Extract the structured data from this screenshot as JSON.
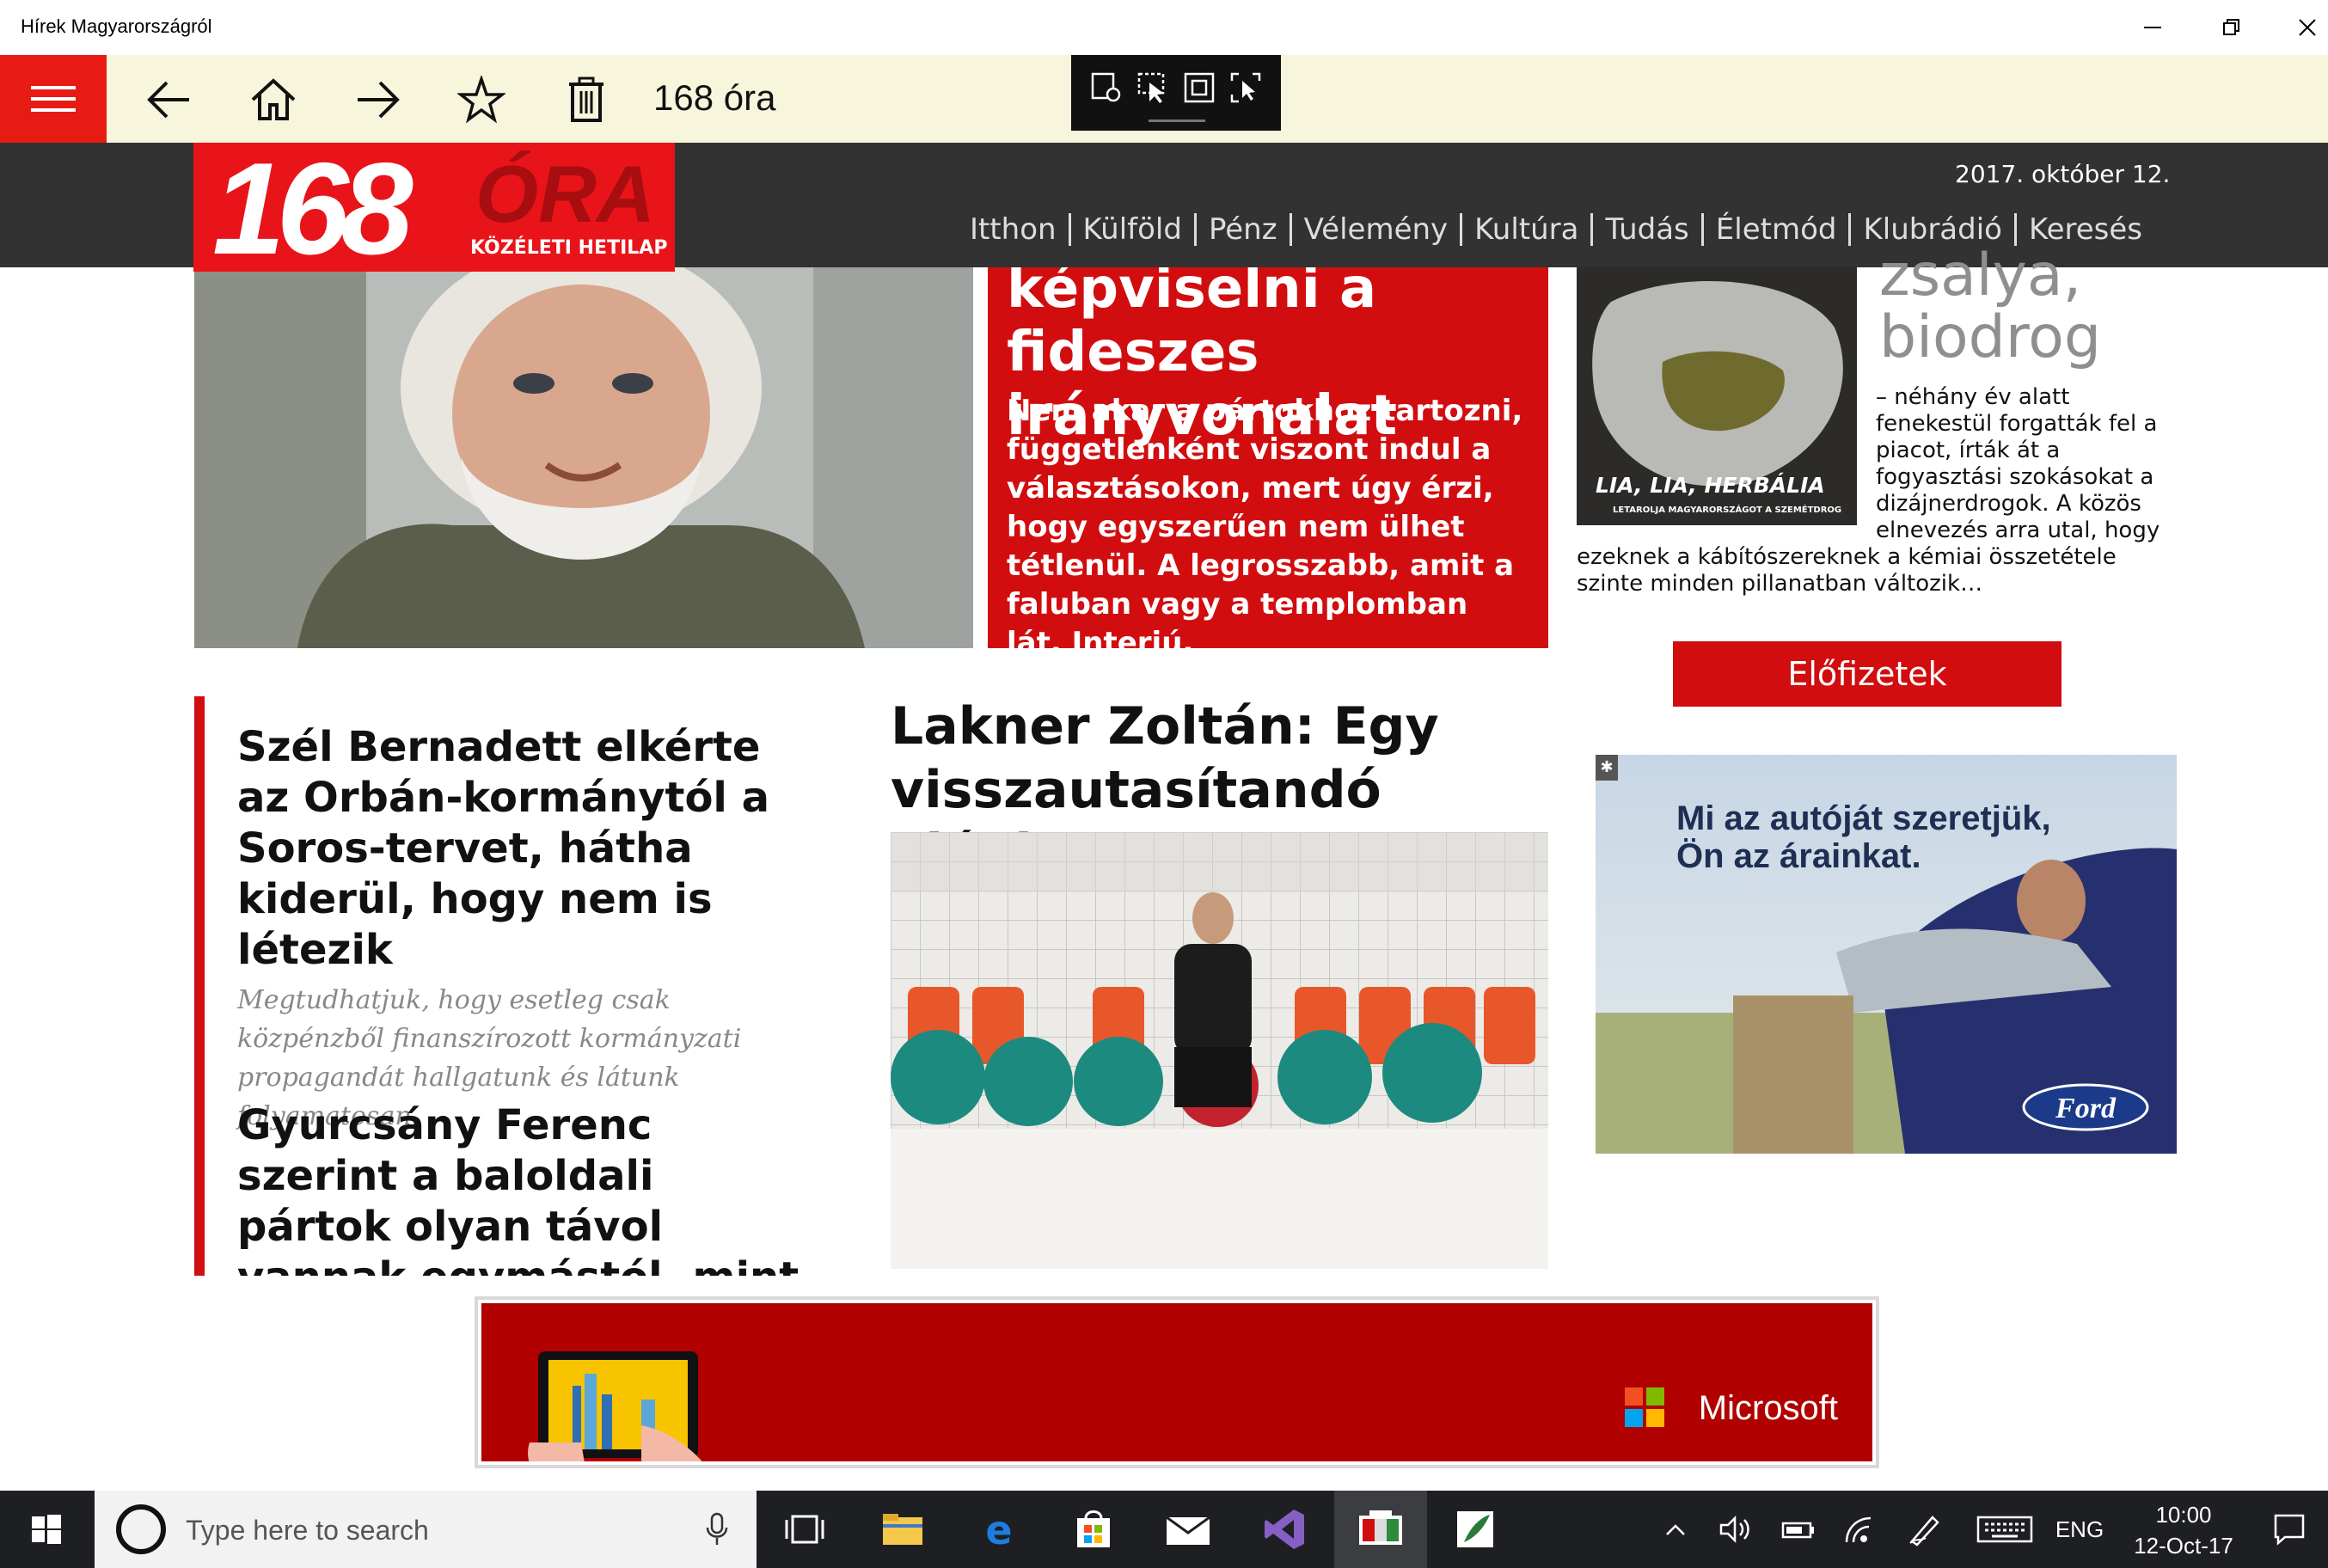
{
  "window": {
    "title": "Hírek Magyarországról"
  },
  "toolbar": {
    "title": "168 óra"
  },
  "site": {
    "logo_number": "168",
    "logo_word": "ÓRA",
    "logo_sub": "KÖZÉLETI HETILAP",
    "date": "2017. október 12.",
    "nav": [
      "Itthon",
      "Külföld",
      "Pénz",
      "Vélemény",
      "Kultúra",
      "Tudás",
      "Életmód",
      "Klubrádió",
      "Keresés"
    ]
  },
  "hero": {
    "title_lines": [
      "képviselni a",
      "fideszes",
      "irányvonalat"
    ],
    "lead": "Nem akar a pártokhoz tartozni, függetlenként viszont indul a választásokon, mert úgy érzi, hogy egyszerűen nem ülhet tétlenül. A legrosszabb, amit a faluban vagy a templomban lát. Interjú."
  },
  "side": {
    "cover_caption": "LIA, LIA, HERBÁLIA",
    "cover_subcaption": "LETAROLJA MAGYARORSZÁGOT A SZEMÉTDROG",
    "title_lines": [
      "zsalya,",
      "biodrog"
    ],
    "text_indented": "– néhány év alatt fenekestül forgatták fel a piacot, írták át a fogyasztási szokásokat a dizájnerdrogok. A közös elnevezés arra utal, hogy",
    "text_full": "ezeknek a kábítószereknek a kémiai összetétele szinte minden pillanatban változik…",
    "subscribe_label": "Előfizetek"
  },
  "articles": [
    {
      "title": "Szél Bernadett elkérte az Orbán-kormánytól a Soros-tervet, hátha kiderül, hogy nem is létezik",
      "lead": "Megtudhatjuk, hogy esetleg csak közpénzből finanszírozott kormányzati propagandát hallgatunk és látunk folyamatosan."
    },
    {
      "title": "Gyurcsány Ferenc szerint a baloldali pártok olyan távol vannak egymástól, mint a Fidesz a KDNP-től"
    }
  ],
  "featured": {
    "title": "Lakner Zoltán: Egy visszautasítandó ajánlat"
  },
  "ads": {
    "ford_text_line1": "Mi az autóját szeretjük,",
    "ford_text_line2": "Ön az árainkat.",
    "ford_brand": "Ford",
    "ms_brand": "Microsoft"
  },
  "taskbar": {
    "search_placeholder": "Type here to search",
    "language": "ENG",
    "time": "10:00",
    "date": "12-Oct-17"
  },
  "colors": {
    "brand_red": "#e81b14",
    "article_red": "#d10d0f",
    "header_dark": "#323232",
    "toolbar_bg": "#f7f6dc"
  }
}
